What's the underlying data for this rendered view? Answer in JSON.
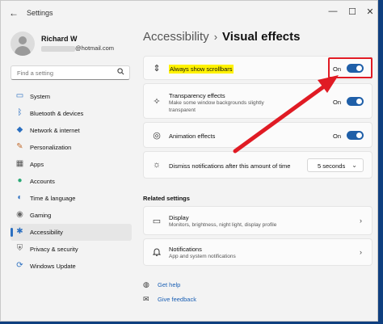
{
  "window": {
    "back_glyph": "←",
    "app_title": "Settings",
    "controls": {
      "minimize": "—",
      "maximize": "☐",
      "close": "✕"
    }
  },
  "profile": {
    "name": "Richard W",
    "email_suffix": "@hotmail.com"
  },
  "search": {
    "placeholder": "Find a setting",
    "icon": "search-icon"
  },
  "sidebar": {
    "items": [
      {
        "label": "System",
        "icon": "monitor-icon",
        "glyph": "▭",
        "color": "#2b6fc0",
        "active": false
      },
      {
        "label": "Bluetooth & devices",
        "icon": "bluetooth-icon",
        "glyph": "ᛒ",
        "color": "#2b6fc0",
        "active": false
      },
      {
        "label": "Network & internet",
        "icon": "wifi-icon",
        "glyph": "◆",
        "color": "#2b6fc0",
        "active": false
      },
      {
        "label": "Personalization",
        "icon": "brush-icon",
        "glyph": "✎",
        "color": "#c26b2d",
        "active": false
      },
      {
        "label": "Apps",
        "icon": "apps-icon",
        "glyph": "▦",
        "color": "#555555",
        "active": false
      },
      {
        "label": "Accounts",
        "icon": "person-icon",
        "glyph": "●",
        "color": "#2aa876",
        "active": false
      },
      {
        "label": "Time & language",
        "icon": "globe-clock-icon",
        "glyph": "◐",
        "color": "#2b6fc0",
        "active": false
      },
      {
        "label": "Gaming",
        "icon": "gamepad-icon",
        "glyph": "◉",
        "color": "#666666",
        "active": false
      },
      {
        "label": "Accessibility",
        "icon": "accessibility-icon",
        "glyph": "✱",
        "color": "#2b6fc0",
        "active": true
      },
      {
        "label": "Privacy & security",
        "icon": "shield-icon",
        "glyph": "⛨",
        "color": "#666666",
        "active": false
      },
      {
        "label": "Windows Update",
        "icon": "refresh-icon",
        "glyph": "⟳",
        "color": "#2b6fc0",
        "active": false
      }
    ]
  },
  "breadcrumb": {
    "parent": "Accessibility",
    "separator": "›",
    "current": "Visual effects"
  },
  "settings": [
    {
      "title": "Always show scrollbars",
      "subtitle": "",
      "icon": "scrollbar-arrows-icon",
      "glyph": "⇕",
      "state": "On",
      "highlighted": true
    },
    {
      "title": "Transparency effects",
      "subtitle": "Make some window backgrounds slightly transparent",
      "icon": "sparkle-icon",
      "glyph": "✧",
      "state": "On",
      "highlighted": false
    },
    {
      "title": "Animation effects",
      "subtitle": "",
      "icon": "animation-icon",
      "glyph": "◎",
      "state": "On",
      "highlighted": false
    },
    {
      "title": "Dismiss notifications after this amount of time",
      "subtitle": "",
      "icon": "sun-icon",
      "glyph": "☼",
      "value": "5 seconds"
    }
  ],
  "related": {
    "heading": "Related settings",
    "items": [
      {
        "title": "Display",
        "subtitle": "Monitors, brightness, night light, display profile",
        "icon": "display-icon",
        "glyph": "▭"
      },
      {
        "title": "Notifications",
        "subtitle": "App and system notifications",
        "icon": "bell-icon",
        "glyph": "♫"
      }
    ]
  },
  "links": [
    {
      "label": "Get help",
      "icon": "help-icon",
      "glyph": "◍"
    },
    {
      "label": "Give feedback",
      "icon": "feedback-icon",
      "glyph": "✉"
    }
  ],
  "annotation": {
    "box_color": "#e01b24",
    "arrow_color": "#e01b24"
  },
  "colors": {
    "accent": "#1f5fa8",
    "highlight": "#fff200"
  }
}
